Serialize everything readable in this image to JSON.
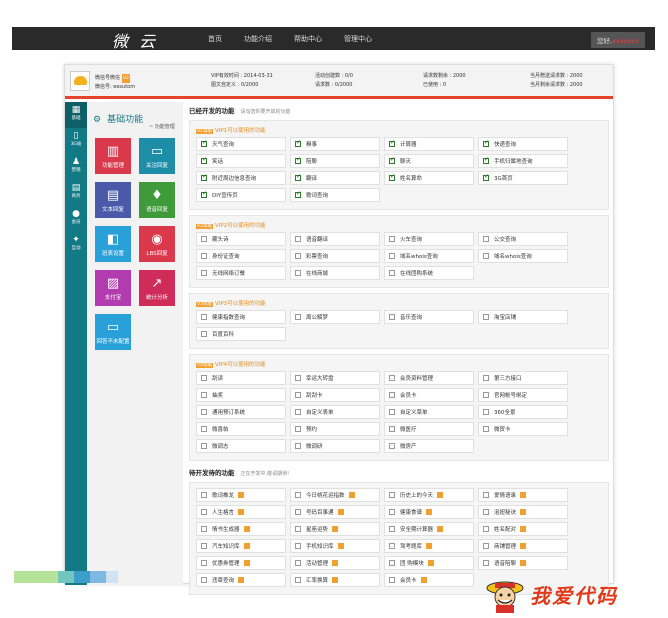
{
  "nav": {
    "logo": "微 云",
    "items": [
      "首页",
      "功能介绍",
      "帮助中心",
      "管理中心"
    ],
    "greeting": "您好,",
    "username": "xxxxxxx"
  },
  "account": {
    "name": "微信号微信",
    "vip": "V2",
    "wechat": "微信号: eesutom"
  },
  "stats": {
    "vip_time": "VIP有效时间 : 2014-03-31",
    "rule_count": "活动创建数 : 0/0",
    "req_left": "请求数剩余 : 2000",
    "req_month": "当月赠送请求数 : 2000",
    "custom_graphic": "图文自定义 : 0/2000",
    "req_count": "请求数 : 0/2000",
    "used": "已使用 : 0",
    "req_month_left": "当月剩余请求数 : 2000"
  },
  "sidebar": [
    {
      "icon": "▦",
      "label": "基础"
    },
    {
      "icon": "▯",
      "label": "3G站"
    },
    {
      "icon": "♟",
      "label": "营销"
    },
    {
      "icon": "▤",
      "label": "商务"
    },
    {
      "icon": "●",
      "label": "会员"
    },
    {
      "icon": "✦",
      "label": "互动"
    }
  ],
  "panel": {
    "title": "基础功能",
    "sub": "~ 功能管理",
    "tiles": [
      {
        "icon": "▥",
        "label": "功能管理"
      },
      {
        "icon": "▭",
        "label": "关注回复"
      },
      {
        "icon": "▤",
        "label": "文本回复"
      },
      {
        "icon": "♦",
        "label": "语音回复"
      },
      {
        "icon": "◧",
        "label": "班表设置"
      },
      {
        "icon": "◉",
        "label": "LBS回复"
      },
      {
        "icon": "▨",
        "label": "支付宝"
      },
      {
        "icon": "↗",
        "label": "统计分析"
      },
      {
        "icon": "▭",
        "label": "回答不未配置"
      }
    ]
  },
  "content": {
    "title": "已经开发的功能",
    "title_hint": "请勾选你要开启的功能",
    "groups": [
      {
        "tag": "V1等级",
        "header": "VIP1可以使用的功能",
        "items": [
          {
            "label": "天气查询",
            "on": true
          },
          {
            "label": "糗事",
            "on": true
          },
          {
            "label": "计算器",
            "on": true
          },
          {
            "label": "快递查询",
            "on": true
          },
          {
            "label": "笑话",
            "on": true
          },
          {
            "label": "陪聊",
            "on": true
          },
          {
            "label": "聊天",
            "on": true
          },
          {
            "label": "手机归属地查询",
            "on": true
          },
          {
            "label": "附近周边信息查询",
            "on": true
          },
          {
            "label": "翻译",
            "on": true
          },
          {
            "label": "姓名算命",
            "on": true
          },
          {
            "label": "3G首页",
            "on": true
          },
          {
            "label": "DIY宣传页",
            "on": true
          },
          {
            "label": "歌词查询",
            "on": true
          }
        ]
      },
      {
        "tag": "V2等级",
        "header": "VIP2可以使用的功能",
        "items": [
          {
            "label": "藏头诗",
            "on": false
          },
          {
            "label": "语音翻译",
            "on": false
          },
          {
            "label": "火车查询",
            "on": false
          },
          {
            "label": "公交查询",
            "on": false
          },
          {
            "label": "身份证查询",
            "on": false
          },
          {
            "label": "彩票查询",
            "on": false
          },
          {
            "label": "域名whois查询",
            "on": false
          },
          {
            "label": "域名whois查询",
            "on": false
          },
          {
            "label": "无线网络订餐",
            "on": false
          },
          {
            "label": "在线商城",
            "on": false
          },
          {
            "label": "在线团购系统",
            "on": false
          }
        ]
      },
      {
        "tag": "V3等级",
        "header": "VIP3可以使用的功能",
        "items": [
          {
            "label": "健康指数查询",
            "on": false
          },
          {
            "label": "周公解梦",
            "on": false
          },
          {
            "label": "音乐查询",
            "on": false
          },
          {
            "label": "淘宝店铺",
            "on": false
          },
          {
            "label": "百度百科",
            "on": false
          }
        ]
      },
      {
        "tag": "V4等级",
        "header": "VIP4可以使用的功能",
        "items": [
          {
            "label": "刮读",
            "on": false
          },
          {
            "label": "幸运大转盘",
            "on": false
          },
          {
            "label": "会员资料管理",
            "on": false
          },
          {
            "label": "第三方接口",
            "on": false
          },
          {
            "label": "抽奖",
            "on": false
          },
          {
            "label": "刮刮卡",
            "on": false
          },
          {
            "label": "会员卡",
            "on": false
          },
          {
            "label": "官网帐号绑定",
            "on": false
          },
          {
            "label": "通用预订系统",
            "on": false
          },
          {
            "label": "自定义表单",
            "on": false
          },
          {
            "label": "自定义菜单",
            "on": false
          },
          {
            "label": "360全景",
            "on": false
          },
          {
            "label": "微喜帖",
            "on": false
          },
          {
            "label": "预约",
            "on": false
          },
          {
            "label": "微医疗",
            "on": false
          },
          {
            "label": "微贺卡",
            "on": false
          },
          {
            "label": "微调志",
            "on": false
          },
          {
            "label": "微调研",
            "on": false
          },
          {
            "label": "微房产",
            "on": false
          }
        ]
      }
    ],
    "pending_title": "待开发待的功能",
    "pending_hint": "正在开发中,敬请期待!",
    "pending": [
      "歌词推龙",
      "今日桃花运指数",
      "历史上的今天",
      "爱情语录",
      "人生格言",
      "号码百事通",
      "健康食谱",
      "泡妞秘诀",
      "情书生成器",
      "星座运势",
      "安全期计算器",
      "姓名配对",
      "汽车知识库",
      "手机知识库",
      "驾考题库",
      "商铺管理",
      "优惠券管理",
      "活动管理",
      "团 购模块",
      "语音陪聊",
      "违章查询",
      "汇率换算",
      "会员卡"
    ]
  },
  "footer": {
    "brand": "我爱代码"
  }
}
